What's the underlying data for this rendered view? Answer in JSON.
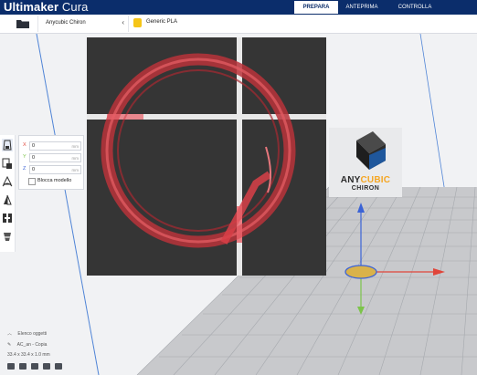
{
  "app": {
    "brand_bold": "Ultimaker",
    "brand_light": "Cura"
  },
  "tabs": [
    "PREPARA",
    "ANTEPRIMA",
    "CONTROLLA"
  ],
  "active_tab": "PREPARA",
  "printer": {
    "name": "Anycubic Chiron",
    "chevron": "‹"
  },
  "material": {
    "label": "Generic PLA",
    "color": "#f5c518"
  },
  "move_panel": {
    "x": {
      "label": "X",
      "value": "0",
      "unit": "mm",
      "color": "#e0453a"
    },
    "y": {
      "label": "Y",
      "value": "0",
      "unit": "mm",
      "color": "#7cc44a"
    },
    "z": {
      "label": "Z",
      "value": "0",
      "unit": "mm",
      "color": "#3b63d6"
    },
    "lock_label": "Blocca modello"
  },
  "build_plate": {
    "brand_a": "ANY",
    "brand_b": "CUBIC",
    "model": "CHIRON"
  },
  "object_list": {
    "header": "Elenco oggetti",
    "object_name": "AC_an - Copia",
    "dimensions": "33.4 x 33.4 x 1.0 mm"
  }
}
